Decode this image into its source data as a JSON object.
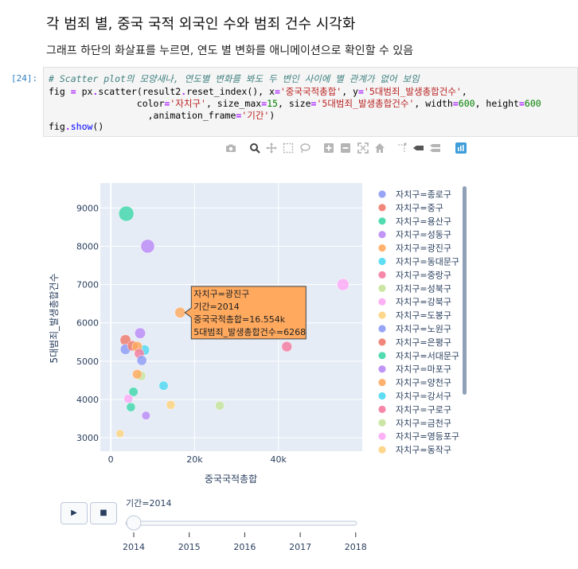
{
  "markdown": {
    "heading": "각 범죄 별, 중국 국적 외국인 수와 범죄 건수 시각화",
    "paragraph": "그래프 하단의 화살표를 누르면, 연도 별 변화를 애니메이션으로 확인할 수 있음"
  },
  "cell": {
    "prompt": "[24]:",
    "line1": "# Scatter plot의 모양새나, 연도별 변화를 봐도 두 변인 사이에 별 관계가 없어 보임",
    "line2": {
      "a": "fig ",
      "eq": "=",
      "b": " px",
      "dot": ".",
      "c": "scatter(result2",
      "dot2": ".",
      "d": "reset_index(), x",
      "eq2": "=",
      "s1": "'중국국적총합'",
      "e": ", y",
      "eq3": "=",
      "s2": "'5대범죄_발생총합건수'",
      "f": ","
    },
    "line3": {
      "a": "                color",
      "eq": "=",
      "s1": "'자치구'",
      "b": ", size_max",
      "eq2": "=",
      "n1": "15",
      "c": ", size",
      "eq3": "=",
      "s2": "'5대범죄_발생총합건수'",
      "d": ", width",
      "eq4": "=",
      "n2": "600",
      "e": ", height",
      "eq5": "=",
      "n3": "600"
    },
    "line4": {
      "a": "                  ,animation_frame",
      "eq": "=",
      "s1": "'기간'",
      "b": ")"
    },
    "line5": {
      "a": "fig",
      "dot": ".",
      "b": "show",
      "c": "()"
    }
  },
  "modebar": {
    "icons": [
      "camera-icon",
      "zoom-icon",
      "pan-icon",
      "box-select-icon",
      "lasso-icon",
      "zoom-in-icon",
      "zoom-out-icon",
      "autoscale-icon",
      "home-icon",
      "spike-lines-icon",
      "hover-closest-icon",
      "hover-compare-icon",
      "plotly-logo-icon"
    ]
  },
  "chart_data": {
    "type": "scatter",
    "title": "",
    "xlabel": "중국국적총합",
    "ylabel": "5대범죄_발생총합건수",
    "xlim": [
      -2500,
      60000
    ],
    "ylim": [
      2650,
      9650
    ],
    "xticks": [
      0,
      20000,
      40000
    ],
    "xtick_labels": [
      "0",
      "20k",
      "40k"
    ],
    "yticks": [
      3000,
      4000,
      5000,
      6000,
      7000,
      8000,
      9000
    ],
    "ytick_labels": [
      "3000",
      "4000",
      "5000",
      "6000",
      "7000",
      "8000",
      "9000"
    ],
    "grid": true,
    "legend_position": "right",
    "size_max": 15,
    "legend": [
      {
        "label": "자치구=종로구",
        "color": "#8c9bf5"
      },
      {
        "label": "자치구=중구",
        "color": "#ef7a6c"
      },
      {
        "label": "자치구=용산구",
        "color": "#3fd7a9"
      },
      {
        "label": "자치구=성동구",
        "color": "#b98af5"
      },
      {
        "label": "자치구=광진구",
        "color": "#ffa95e"
      },
      {
        "label": "자치구=동대문구",
        "color": "#4ed9f2"
      },
      {
        "label": "자치구=중랑구",
        "color": "#f57a9e"
      },
      {
        "label": "자치구=성북구",
        "color": "#c5e39a"
      },
      {
        "label": "자치구=강북구",
        "color": "#fca8f4"
      },
      {
        "label": "자치구=도봉구",
        "color": "#fdd37e"
      },
      {
        "label": "자치구=노원구",
        "color": "#8c9bf5"
      },
      {
        "label": "자치구=은평구",
        "color": "#ef7a6c"
      },
      {
        "label": "자치구=서대문구",
        "color": "#3fd7a9"
      },
      {
        "label": "자치구=마포구",
        "color": "#b98af5"
      },
      {
        "label": "자치구=양천구",
        "color": "#ffa95e"
      },
      {
        "label": "자치구=강서구",
        "color": "#4ed9f2"
      },
      {
        "label": "자치구=구로구",
        "color": "#f57a9e"
      },
      {
        "label": "자치구=금천구",
        "color": "#c5e39a"
      },
      {
        "label": "자치구=영등포구",
        "color": "#fca8f4"
      },
      {
        "label": "자치구=동작구",
        "color": "#fdd37e"
      }
    ],
    "points": [
      {
        "x": 3700,
        "y": 8850,
        "color": "#3fd7a9",
        "r": 9.5
      },
      {
        "x": 8800,
        "y": 8000,
        "color": "#b98af5",
        "r": 8.6
      },
      {
        "x": 55400,
        "y": 7000,
        "color": "#fca8f4",
        "r": 7.5
      },
      {
        "x": 16554,
        "y": 6268,
        "color": "#ffa95e",
        "r": 6.7
      },
      {
        "x": 42000,
        "y": 5380,
        "color": "#f57a9e",
        "r": 6.5
      },
      {
        "x": 7000,
        "y": 5730,
        "color": "#b98af5",
        "r": 6.8
      },
      {
        "x": 3500,
        "y": 5550,
        "color": "#ef7a6c",
        "r": 6.8
      },
      {
        "x": 3500,
        "y": 5310,
        "color": "#8c9bf5",
        "r": 6.5
      },
      {
        "x": 5200,
        "y": 5400,
        "color": "#ef7a6c",
        "r": 6.5
      },
      {
        "x": 8000,
        "y": 5290,
        "color": "#4ed9f2",
        "r": 6.5
      },
      {
        "x": 6300,
        "y": 5380,
        "color": "#ffa95e",
        "r": 6.5
      },
      {
        "x": 6800,
        "y": 5200,
        "color": "#f57a9e",
        "r": 6.2
      },
      {
        "x": 7400,
        "y": 5020,
        "color": "#8c9bf5",
        "r": 6.2
      },
      {
        "x": 7200,
        "y": 4620,
        "color": "#c5e39a",
        "r": 6.0
      },
      {
        "x": 6300,
        "y": 4660,
        "color": "#ffa95e",
        "r": 6.0
      },
      {
        "x": 12600,
        "y": 4360,
        "color": "#4ed9f2",
        "r": 5.8
      },
      {
        "x": 5400,
        "y": 4200,
        "color": "#3fd7a9",
        "r": 5.8
      },
      {
        "x": 4200,
        "y": 4020,
        "color": "#fca8f4",
        "r": 5.6
      },
      {
        "x": 14300,
        "y": 3860,
        "color": "#fdd37e",
        "r": 5.6
      },
      {
        "x": 26000,
        "y": 3840,
        "color": "#c5e39a",
        "r": 5.6
      },
      {
        "x": 4800,
        "y": 3800,
        "color": "#3fd7a9",
        "r": 5.6
      },
      {
        "x": 8400,
        "y": 3580,
        "color": "#b98af5",
        "r": 5.3
      },
      {
        "x": 2200,
        "y": 3110,
        "color": "#fdd37e",
        "r": 5.0
      }
    ],
    "hover": {
      "x": 16554,
      "y": 6268,
      "color": "#ffa95e",
      "lines": [
        "자치구=광진구",
        "기간=2014",
        "중국국적총합=16.554k",
        "5대범죄_발생총합건수=6268"
      ]
    }
  },
  "animation": {
    "play_label": "▶",
    "pause_label": "■",
    "current_label": "기간=2014",
    "years": [
      "2014",
      "2015",
      "2016",
      "2017",
      "2018"
    ],
    "current_index": 0
  }
}
